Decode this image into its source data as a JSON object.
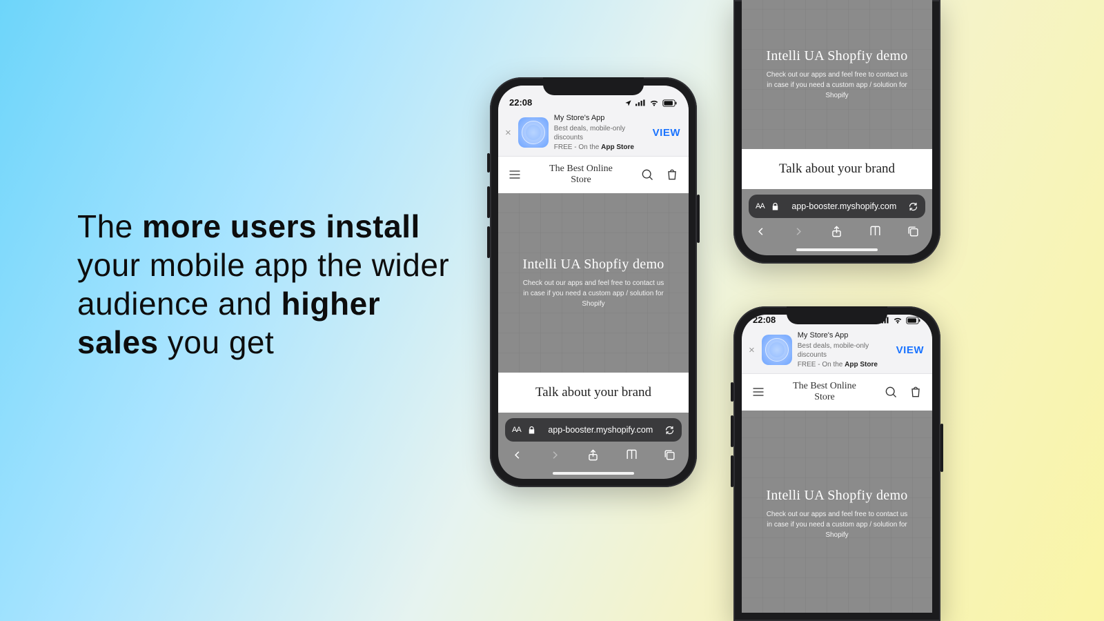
{
  "headline": {
    "pre": "The ",
    "bold1": "more users install",
    "mid": " your mobile app the wider audience and ",
    "bold2": "higher sales",
    "post": " you get"
  },
  "status": {
    "time": "22:08",
    "location_arrow": "➤"
  },
  "smartbanner": {
    "close": "×",
    "title": "My Store's App",
    "line2": "Best deals, mobile-only discounts",
    "line3_pre": "FREE - On the ",
    "line3_bold": "App Store",
    "view": "VIEW"
  },
  "store_header": {
    "line1": "The Best Online",
    "line2": "Store"
  },
  "hero": {
    "title": "Intelli UA Shopfiy demo",
    "desc": "Check out our apps and feel free to contact us in case if you need a custom app / solution for Shopify"
  },
  "talk_band": "Talk about your brand",
  "urlbar": {
    "aa": "AA",
    "host": "app-booster.myshopify.com"
  }
}
